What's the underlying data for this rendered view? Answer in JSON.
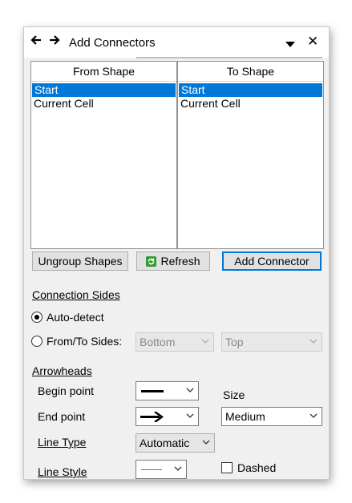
{
  "window": {
    "title": "Add Connectors",
    "back_icon": "arrow-left-icon",
    "forward_icon": "arrow-right-icon",
    "menu_icon": "dropdown-triangle-icon",
    "close_icon": "close-icon"
  },
  "from_shape": {
    "header": "From Shape",
    "items": [
      {
        "label": "Start",
        "selected": true
      },
      {
        "label": "Current Cell",
        "selected": false
      }
    ]
  },
  "to_shape": {
    "header": "To Shape",
    "items": [
      {
        "label": "Start",
        "selected": true
      },
      {
        "label": "Current Cell",
        "selected": false
      }
    ]
  },
  "buttons": {
    "ungroup": "Ungroup Shapes",
    "refresh": "Refresh",
    "add_connector": "Add Connector"
  },
  "connection_sides": {
    "heading": "Connection Sides",
    "auto_detect": "Auto-detect",
    "from_to": "From/To Sides:",
    "from_value": "Bottom",
    "to_value": "Top",
    "selected": "auto_detect"
  },
  "arrowheads": {
    "heading": "Arrowheads",
    "begin_label": "Begin point",
    "end_label": "End point",
    "size_label": "Size",
    "size_value": "Medium"
  },
  "line": {
    "type_label": "Line Type",
    "type_value": "Automatic",
    "style_label": "Line Style",
    "dashed_label": "Dashed",
    "dashed_checked": false
  },
  "colors": {
    "accent": "#0078d7",
    "panel_bg": "#f0f0f0",
    "refresh_icon": "#2e9e2e"
  }
}
